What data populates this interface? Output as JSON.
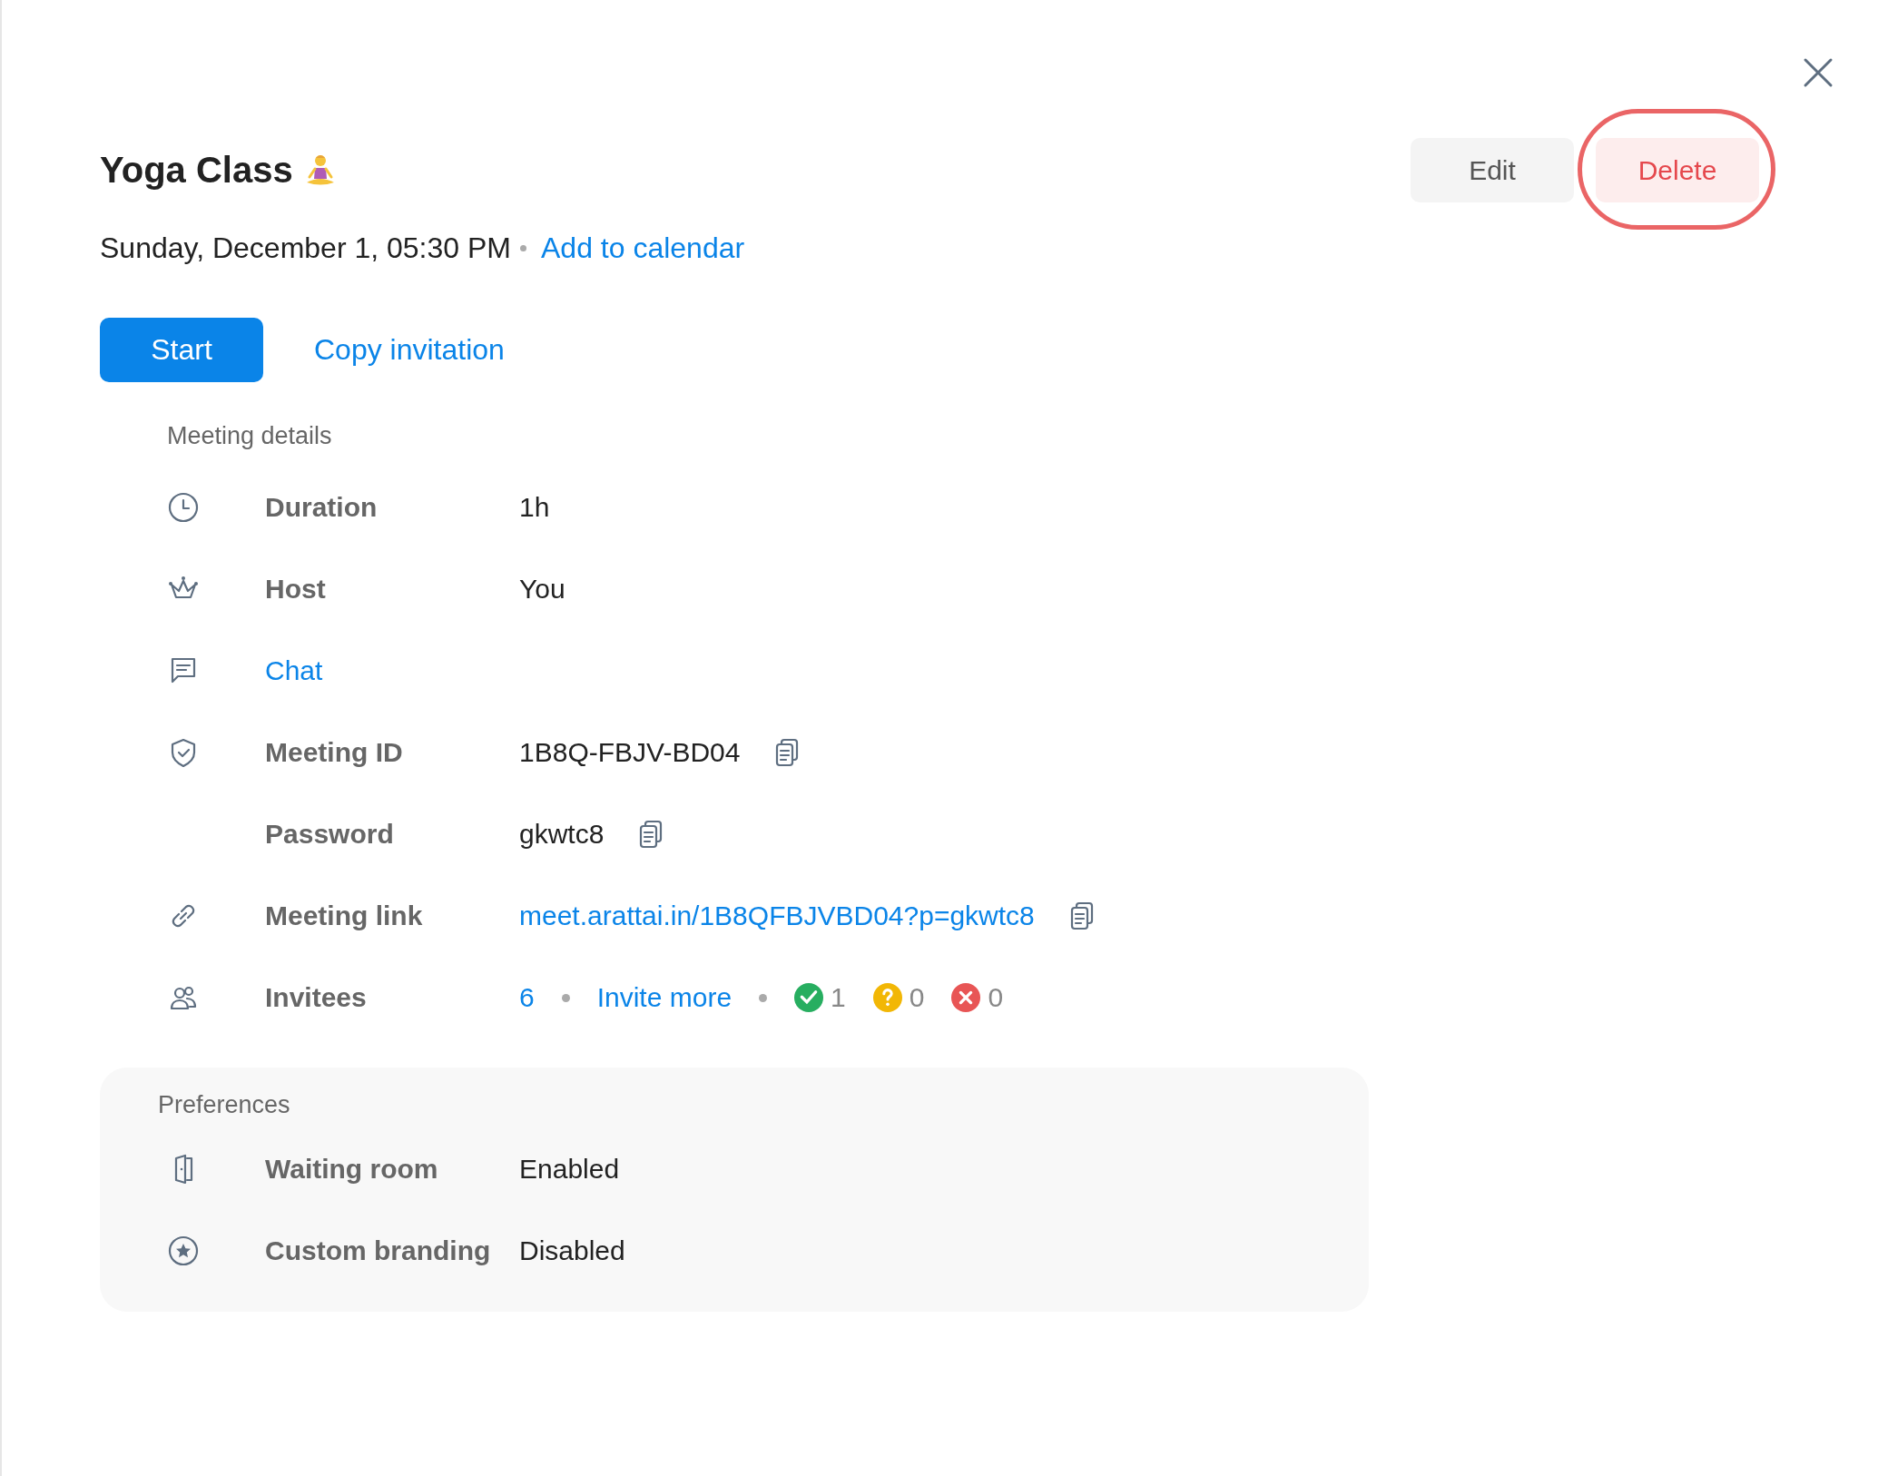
{
  "title": "Yoga Class",
  "actions": [
    {
      "label": "Edit",
      "kind": "neutral",
      "highlighted": false
    },
    {
      "label": "Delete",
      "kind": "danger",
      "highlighted": true
    }
  ],
  "when": "Sunday, December 1, 05:30 PM",
  "add_to_calendar": "Add to calendar",
  "primary": {
    "start": "Start",
    "copy_invitation": "Copy invitation"
  },
  "details": {
    "heading": "Meeting details",
    "rows": [
      {
        "kind": "text",
        "label": "Duration",
        "value": "1h",
        "copyable": false
      },
      {
        "kind": "text",
        "label": "Host",
        "value": "You",
        "copyable": false
      },
      {
        "kind": "link-label",
        "label": "Chat",
        "copyable": false
      },
      {
        "kind": "text",
        "label": "Meeting ID",
        "value": "1B8Q-FBJV-BD04",
        "copyable": true
      },
      {
        "kind": "text",
        "label": "Password",
        "value": "gkwtc8",
        "copyable": true
      },
      {
        "kind": "link-value",
        "label": "Meeting link",
        "value": "meet.arattai.in/1B8QFBJVBD04?p=gkwtc8",
        "copyable": true
      },
      {
        "kind": "invitees",
        "label": "Invitees",
        "count": "6",
        "invite_more": "Invite more"
      }
    ]
  },
  "responses": [
    {
      "kind": "accepted",
      "count": "1",
      "color": "#27ae60"
    },
    {
      "kind": "maybe",
      "count": "0",
      "color": "#f2b705"
    },
    {
      "kind": "declined",
      "count": "0",
      "color": "#e85555"
    }
  ],
  "preferences": {
    "heading": "Preferences",
    "rows": [
      {
        "label": "Waiting room",
        "value": "Enabled"
      },
      {
        "label": "Custom branding",
        "value": "Disabled"
      }
    ]
  }
}
